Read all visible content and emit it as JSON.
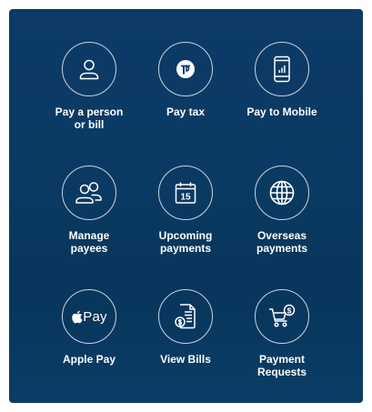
{
  "tiles": [
    {
      "label": "Pay a person\nor bill",
      "icon": "person-icon"
    },
    {
      "label": "Pay tax",
      "icon": "tax-icon"
    },
    {
      "label": "Pay to Mobile",
      "icon": "mobile-phone-icon"
    },
    {
      "label": "Manage\npayees",
      "icon": "people-icon"
    },
    {
      "label": "Upcoming\npayments",
      "icon": "calendar-icon",
      "calendar_day": "15"
    },
    {
      "label": "Overseas\npayments",
      "icon": "globe-icon"
    },
    {
      "label": "Apple Pay",
      "icon": "apple-pay-icon",
      "icon_text": "Pay"
    },
    {
      "label": "View Bills",
      "icon": "bill-document-icon"
    },
    {
      "label": "Payment\nRequests",
      "icon": "shopping-cart-dollar-icon"
    }
  ],
  "colors": {
    "panel_top": "#0d3a67",
    "panel_bottom": "#0a3d66",
    "foreground": "#ffffff"
  }
}
